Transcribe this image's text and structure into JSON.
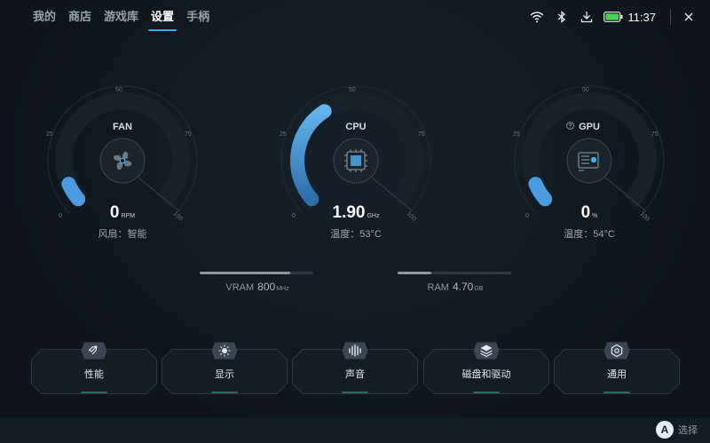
{
  "nav": {
    "tabs": [
      {
        "label": "我的",
        "active": false
      },
      {
        "label": "商店",
        "active": false
      },
      {
        "label": "游戏库",
        "active": false
      },
      {
        "label": "设置",
        "active": true
      },
      {
        "label": "手柄",
        "active": false
      }
    ]
  },
  "status": {
    "icons": [
      "wifi-icon",
      "bluetooth-icon",
      "download-icon",
      "battery-icon"
    ],
    "time": "11:37",
    "close_icon": "close-icon",
    "battery_color": "#49d05a"
  },
  "gauges": {
    "fan": {
      "label": "FAN",
      "value": "0",
      "unit": "RPM",
      "sub": "风扇：智能",
      "level_pct": 8,
      "icon": "fan-icon",
      "ticks": {
        "t0": "0",
        "t25": "25",
        "t50": "50",
        "t75": "75",
        "t100": "100"
      }
    },
    "cpu": {
      "label": "CPU",
      "value": "1.90",
      "unit": "GHz",
      "sub": "温度：53°C",
      "level_pct": 38,
      "icon": "cpu-chip-icon",
      "ticks": {
        "t0": "0",
        "t25": "25",
        "t50": "50",
        "t75": "75",
        "t100": "100"
      }
    },
    "gpu": {
      "label": "GPU",
      "value": "0",
      "unit": "%",
      "sub": "温度：54°C",
      "level_pct": 8,
      "icon": "gpu-card-icon",
      "help_icon": "question-icon",
      "ticks": {
        "t0": "0",
        "t25": "25",
        "t50": "50",
        "t75": "75",
        "t100": "100"
      }
    }
  },
  "bars": {
    "vram": {
      "label": "VRAM",
      "value": "800",
      "unit": "MHz",
      "level_pct": 80
    },
    "ram": {
      "label": "RAM",
      "value": "4.70",
      "unit": "GB",
      "level_pct": 30
    }
  },
  "menu": [
    {
      "label": "性能",
      "icon": "rocket-icon"
    },
    {
      "label": "显示",
      "icon": "brightness-icon"
    },
    {
      "label": "声音",
      "icon": "sound-wave-icon"
    },
    {
      "label": "磁盘和驱动",
      "icon": "layers-icon"
    },
    {
      "label": "通用",
      "icon": "settings-hex-icon"
    }
  ],
  "footer": {
    "button": "A",
    "hint": "选择"
  },
  "colors": {
    "accent": "#3fa7e6",
    "gauge_fill": "#5aa8e0",
    "background": "#0f151b"
  }
}
